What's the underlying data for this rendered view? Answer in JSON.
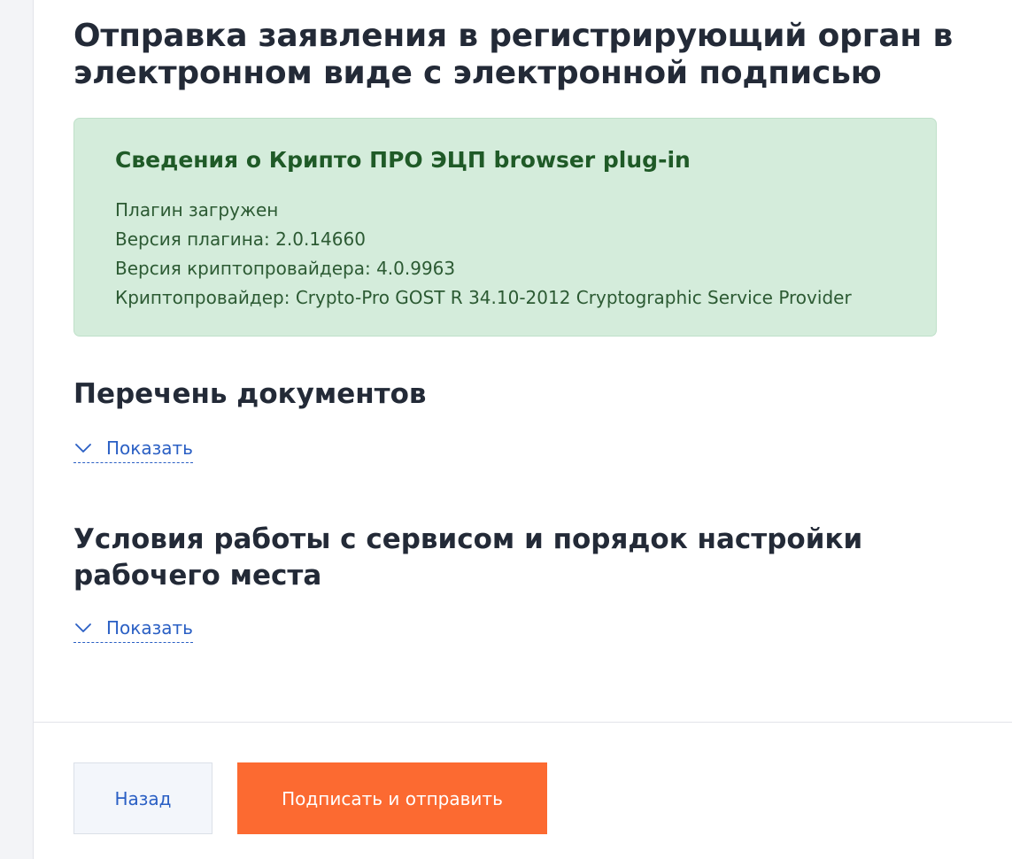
{
  "page": {
    "title": "Отправка заявления в регистрирующий орган в электронном виде с электронной подписью"
  },
  "plugin_info": {
    "title": "Сведения о Крипто ПРО ЭЦП browser plug-in",
    "lines": [
      "Плагин загружен",
      "Версия плагина: 2.0.14660",
      "Версия криптопровайдера: 4.0.9963",
      "Криптопровайдер: Crypto-Pro GOST R 34.10-2012 Cryptographic Service Provider"
    ]
  },
  "sections": [
    {
      "title": "Перечень документов",
      "toggle_label": "Показать",
      "toggle_icon": "chevron-down-icon"
    },
    {
      "title": "Условия работы с сервисом и порядок настройки рабочего места",
      "toggle_label": "Показать",
      "toggle_icon": "chevron-down-icon"
    }
  ],
  "footer": {
    "back_label": "Назад",
    "submit_label": "Подписать и отправить"
  },
  "colors": {
    "accent_orange": "#fc6a31",
    "link_blue": "#2a5fc4",
    "success_bg": "#d4ecdb",
    "success_text": "#1f5a27",
    "heading": "#232a37"
  }
}
